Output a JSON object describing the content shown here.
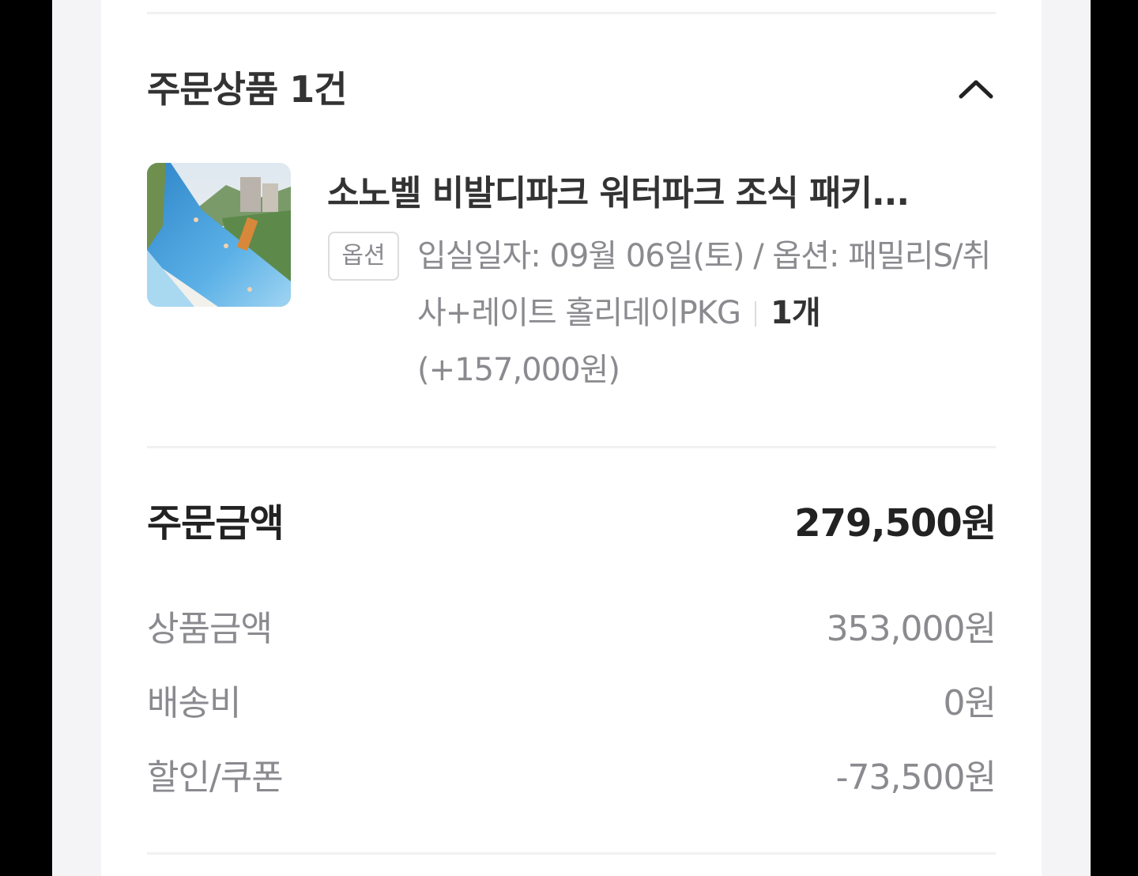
{
  "order_items": {
    "title": "주문상품 1건",
    "toggle_icon": "chevron-up-icon",
    "items": [
      {
        "name": "소노벨 비발디파크 워터파크 조식 패키...",
        "option_badge": "옵션",
        "option_text": "입실일자: 09월 06일(토) / 옵션: 패밀리S/취사+레이트 홀리데이PKG",
        "quantity": "1개",
        "option_price": "(+157,000원)"
      }
    ]
  },
  "summary": {
    "total_label": "주문금액",
    "total_value": "279,500원",
    "rows": [
      {
        "label": "상품금액",
        "value": "353,000원"
      },
      {
        "label": "배송비",
        "value": "0원"
      },
      {
        "label": "할인/쿠폰",
        "value": "-73,500원"
      }
    ]
  },
  "colors": {
    "text_primary": "#333333",
    "text_secondary": "#8a8a8f",
    "divider": "#f1f1f3",
    "background": "#f4f4f6"
  }
}
